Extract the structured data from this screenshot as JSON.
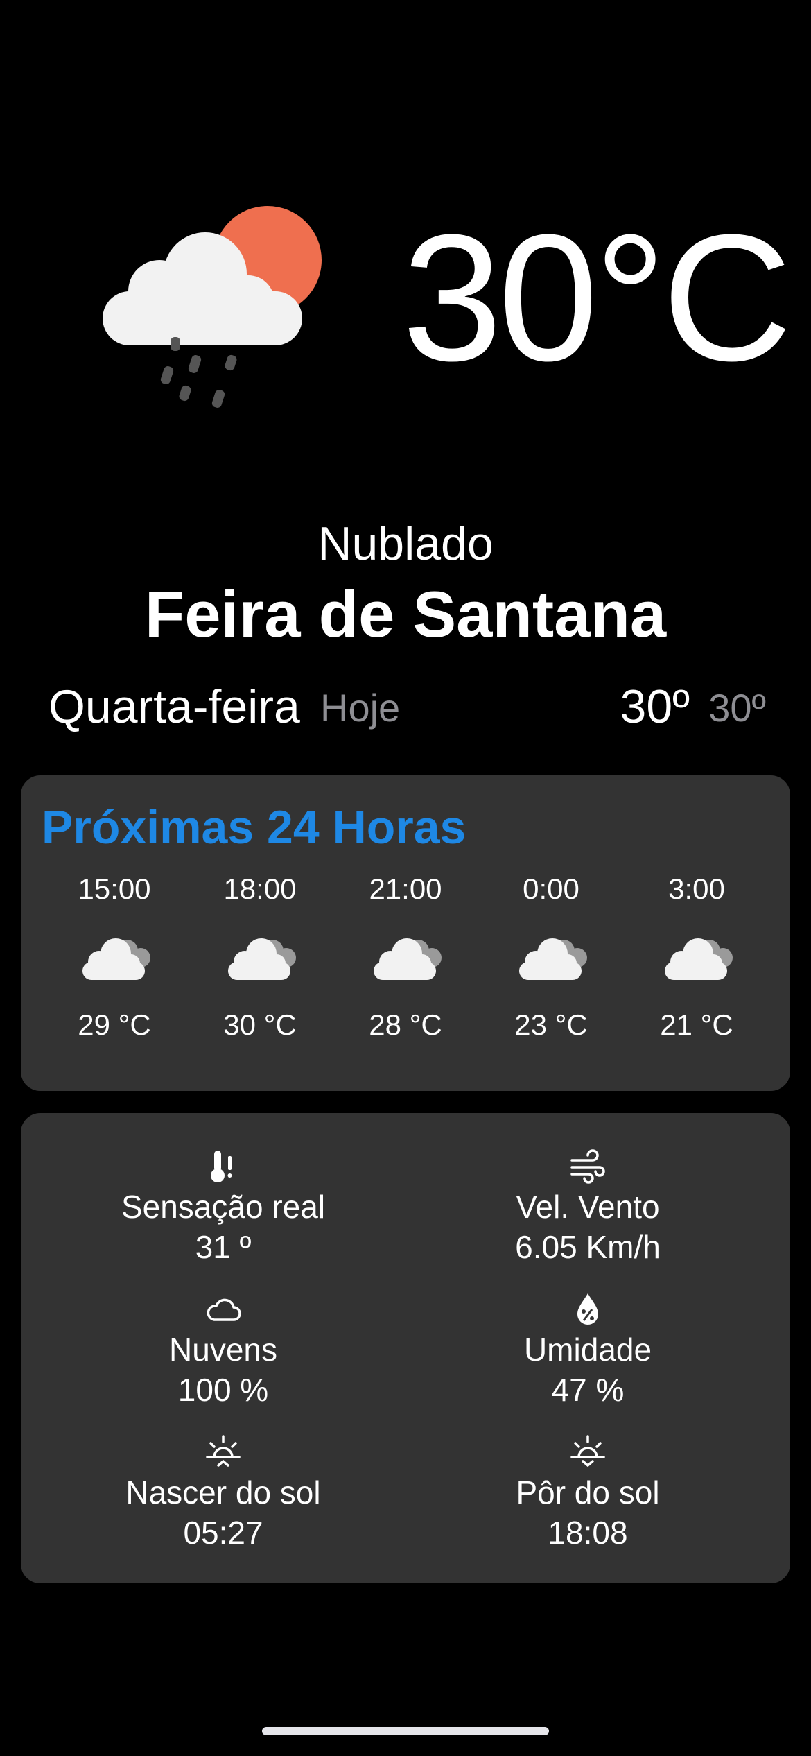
{
  "current": {
    "temperature": "30°C",
    "condition": "Nublado",
    "city": "Feira de Santana",
    "day": "Quarta-feira",
    "today_label": "Hoje",
    "temp_max": "30º",
    "temp_min": "30º",
    "icon": "cloud-sun-rain-icon"
  },
  "hourly": {
    "title": "Próximas 24 Horas",
    "items": [
      {
        "time": "15:00",
        "temp": "29 °C",
        "icon": "cloud-icon"
      },
      {
        "time": "18:00",
        "temp": "30 °C",
        "icon": "cloud-icon"
      },
      {
        "time": "21:00",
        "temp": "28 °C",
        "icon": "cloud-icon"
      },
      {
        "time": "0:00",
        "temp": "23 °C",
        "icon": "cloud-icon"
      },
      {
        "time": "3:00",
        "temp": "21 °C",
        "icon": "cloud-icon"
      }
    ]
  },
  "details": {
    "feels_like": {
      "label": "Sensação real",
      "value": "31 º",
      "icon": "thermometer-alert-icon"
    },
    "wind": {
      "label": "Vel. Vento",
      "value": "6.05 Km/h",
      "icon": "wind-icon"
    },
    "clouds": {
      "label": "Nuvens",
      "value": "100 %",
      "icon": "cloud-outline-icon"
    },
    "humidity": {
      "label": "Umidade",
      "value": "47 %",
      "icon": "humidity-drop-icon"
    },
    "sunrise": {
      "label": "Nascer do sol",
      "value": "05:27",
      "icon": "sunrise-icon"
    },
    "sunset": {
      "label": "Pôr do sol",
      "value": "18:08",
      "icon": "sunset-icon"
    }
  },
  "colors": {
    "background": "#000000",
    "card": "#333333",
    "accent": "#1e88e5",
    "muted": "#8e8e93",
    "sun": "#ef6f4f"
  }
}
